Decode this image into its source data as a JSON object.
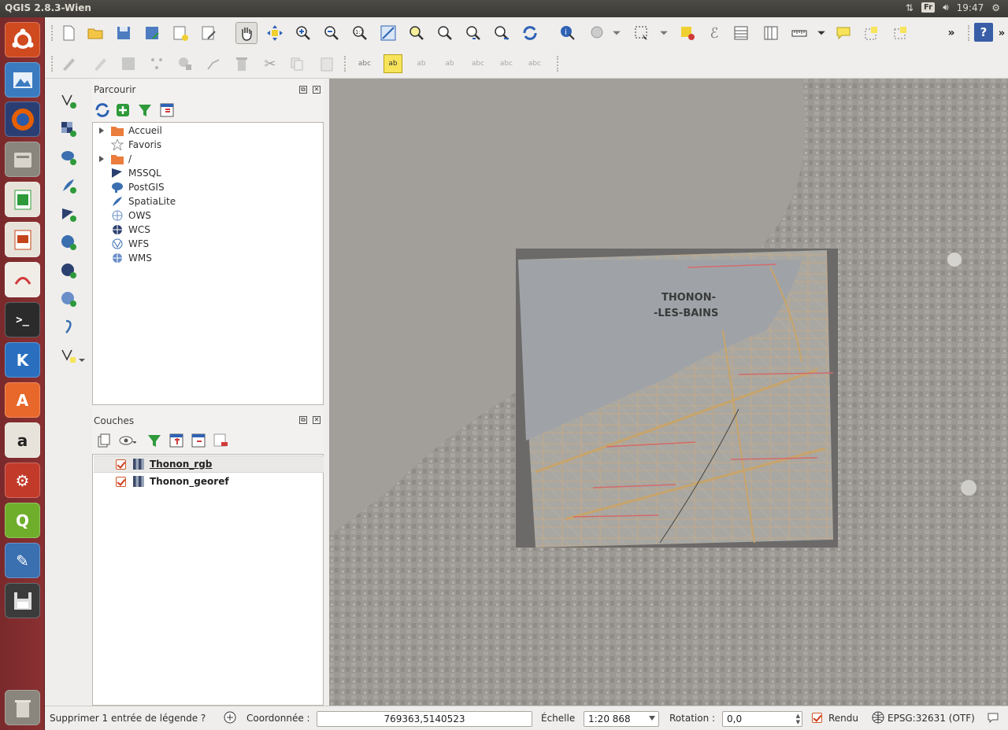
{
  "window": {
    "title": "QGIS 2.8.3-Wien"
  },
  "system_tray": {
    "keyboard_layout": "Fr",
    "clock": "19:47"
  },
  "launcher": [
    {
      "name": "ubuntu-dash-icon",
      "color": "#d04a1f"
    },
    {
      "name": "image-viewer-icon",
      "color": "#3a7bc0"
    },
    {
      "name": "firefox-icon",
      "color": "#e66000"
    },
    {
      "name": "file-manager-icon",
      "color": "#8a857d"
    },
    {
      "name": "calc-spreadsheet-icon",
      "color": "#2e9a3a"
    },
    {
      "name": "impress-presentation-icon",
      "color": "#c4451c"
    },
    {
      "name": "pdf-reader-icon",
      "color": "#d03a3a"
    },
    {
      "name": "terminal-icon",
      "color": "#2b2b2b"
    },
    {
      "name": "keepass-icon",
      "color": "#2a6fbf"
    },
    {
      "name": "software-center-icon",
      "color": "#e8672a"
    },
    {
      "name": "amazon-icon",
      "color": "#e8e3da"
    },
    {
      "name": "system-settings-icon",
      "color": "#c23a2a"
    },
    {
      "name": "qgis-icon",
      "color": "#6fae2b"
    },
    {
      "name": "writer-icon",
      "color": "#3a6fb0"
    },
    {
      "name": "save-disk-icon",
      "color": "#3b3b3b"
    },
    {
      "name": "trash-icon",
      "color": "#8a857d"
    }
  ],
  "browser_panel": {
    "title": "Parcourir",
    "items": [
      {
        "label": "Accueil",
        "icon": "folder-icon",
        "expandable": true
      },
      {
        "label": "Favoris",
        "icon": "star-icon",
        "expandable": false
      },
      {
        "label": "/",
        "icon": "folder-icon",
        "expandable": true
      },
      {
        "label": "MSSQL",
        "icon": "mssql-icon",
        "expandable": false
      },
      {
        "label": "PostGIS",
        "icon": "postgis-elephant-icon",
        "expandable": false
      },
      {
        "label": "SpatiaLite",
        "icon": "spatialite-feather-icon",
        "expandable": false
      },
      {
        "label": "OWS",
        "icon": "ows-globe-icon",
        "expandable": false
      },
      {
        "label": "WCS",
        "icon": "wcs-globe-icon",
        "expandable": false
      },
      {
        "label": "WFS",
        "icon": "wfs-globe-icon",
        "expandable": false
      },
      {
        "label": "WMS",
        "icon": "wms-globe-icon",
        "expandable": false
      }
    ]
  },
  "layers_panel": {
    "title": "Couches",
    "layers": [
      {
        "name": "Thonon_rgb",
        "checked": true,
        "selected": true
      },
      {
        "name": "Thonon_georef",
        "checked": true,
        "selected": false
      }
    ]
  },
  "map": {
    "labels": {
      "city_line1": "THONON-",
      "city_line2": "-LES-BAINS"
    }
  },
  "status_bar": {
    "message": "Supprimer 1 entrée de légende ?",
    "coord_label": "Coordonnée :",
    "coord_value": "769363,5140523",
    "scale_label": "Échelle",
    "scale_value": "1:20 868",
    "rotation_label": "Rotation :",
    "rotation_value": "0,0",
    "render_label": "Rendu",
    "render_checked": true,
    "crs": "EPSG:32631 (OTF)"
  }
}
